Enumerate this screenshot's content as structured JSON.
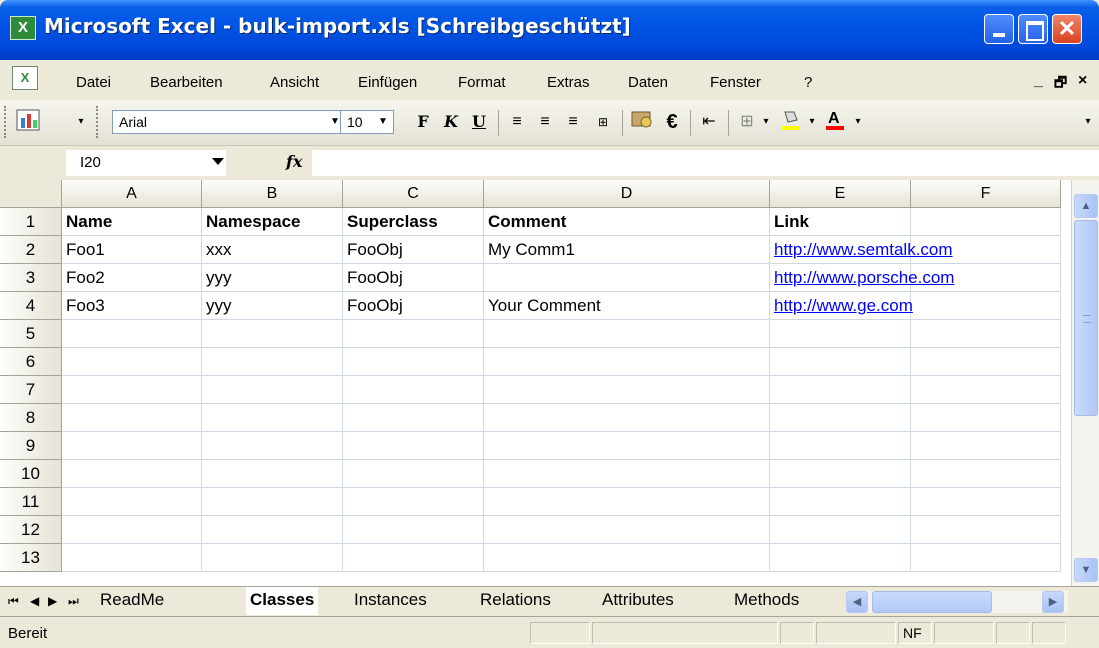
{
  "window": {
    "title": "Microsoft Excel - bulk-import.xls  [Schreibgeschützt]",
    "app_icon": "excel-icon",
    "minimize_icon": "minimize-icon",
    "maximize_icon": "maximize-icon",
    "close_icon": "close-icon",
    "close_glyph": "✕"
  },
  "menu": {
    "items": [
      "Datei",
      "Bearbeiten",
      "Ansicht",
      "Einfügen",
      "Format",
      "Extras",
      "Daten",
      "Fenster",
      "?"
    ],
    "right_minimize": "_",
    "right_restore": "🗗",
    "right_close": "×"
  },
  "toolbar": {
    "font_name": "Arial",
    "font_size": "10",
    "bold_label": "F",
    "italic_label": "K",
    "underline_label": "U",
    "euro_label": "€"
  },
  "formula_bar": {
    "name_box": "I20",
    "fx_label": "fx",
    "formula": ""
  },
  "grid": {
    "columns": [
      "A",
      "B",
      "C",
      "D",
      "E",
      "F"
    ],
    "rows": [
      "1",
      "2",
      "3",
      "4",
      "5",
      "6",
      "7",
      "8",
      "9",
      "10",
      "11",
      "12",
      "13"
    ],
    "cells": [
      [
        "Name",
        "Namespace",
        "Superclass",
        "Comment",
        "Link",
        ""
      ],
      [
        "Foo1",
        "xxx",
        "FooObj",
        "My Comm1",
        "http://www.semtalk.com",
        ""
      ],
      [
        "Foo2",
        "yyy",
        "FooObj",
        "",
        "http://www.porsche.com",
        ""
      ],
      [
        "Foo3",
        "yyy",
        "FooObj",
        "Your Comment",
        "http://www.ge.com",
        ""
      ]
    ]
  },
  "sheets": {
    "tabs": [
      "ReadMe",
      "Classes",
      "Instances",
      "Relations",
      "Attributes",
      "Methods"
    ],
    "active": "Classes"
  },
  "status": {
    "text": "Bereit",
    "indicator": "NF"
  },
  "colors": {
    "title_blue": "#0055e5",
    "link": "#0000ff",
    "gridline": "#d0d7e5"
  }
}
